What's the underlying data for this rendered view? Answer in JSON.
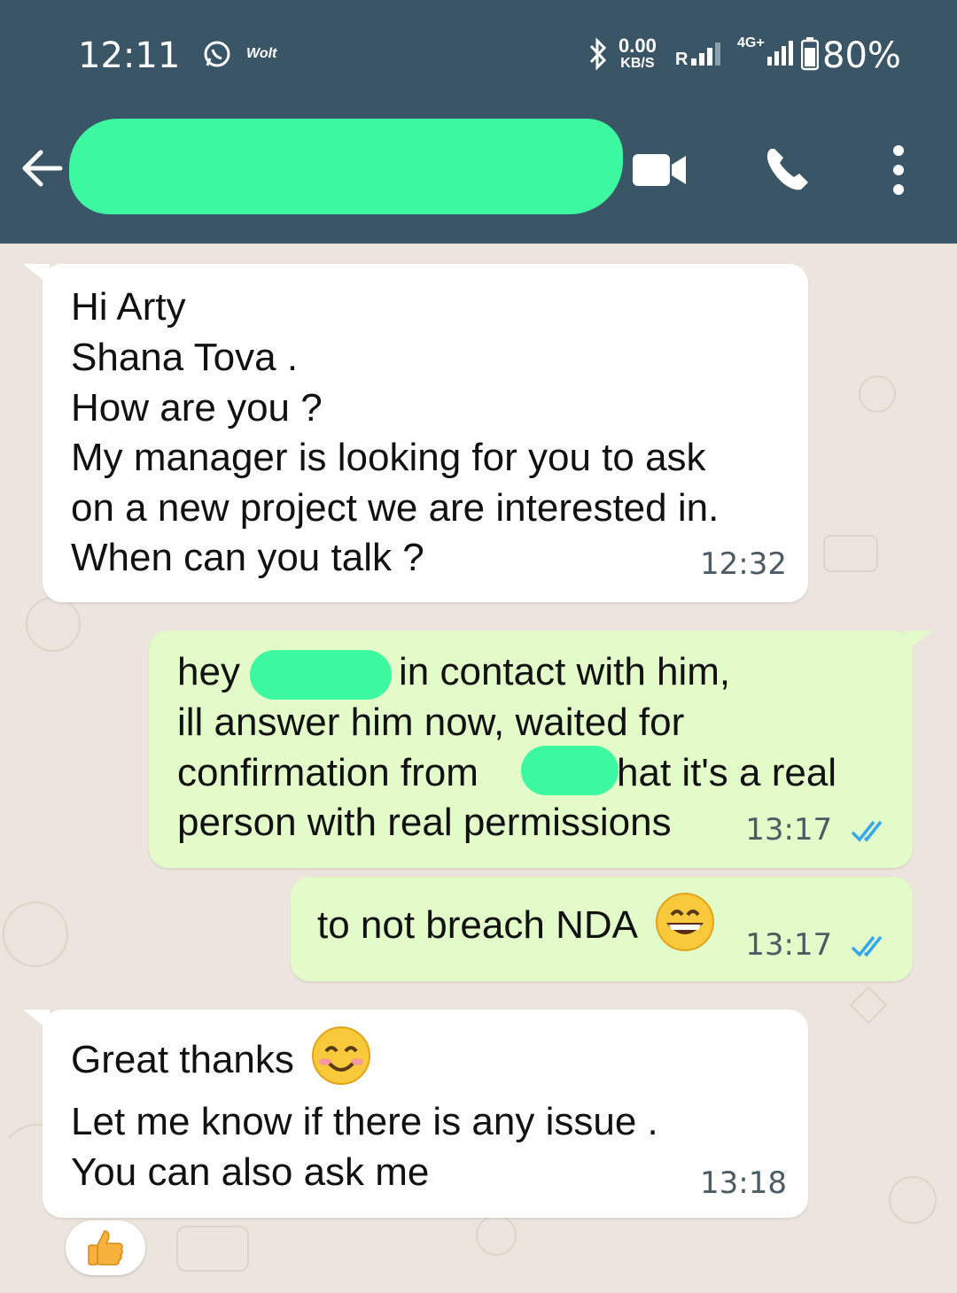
{
  "status_bar": {
    "time": "12:11",
    "wolt": "Wolt",
    "speed_value": "0.00",
    "speed_unit": "KB/S",
    "net1": "R",
    "net2": "4G+",
    "battery": "80%"
  },
  "header": {
    "accent_color": "#3a5566",
    "redaction_color": "#3cf8a0"
  },
  "messages": [
    {
      "direction": "incoming",
      "lines": [
        "Hi Arty",
        "Shana Tova .",
        "How are you ?",
        "My manager is looking for you to ask",
        "on a new project we are interested in.",
        "When can you talk ?"
      ],
      "time": "12:32"
    },
    {
      "direction": "outgoing",
      "lines": [
        "hey",
        "in contact with him,",
        "ill answer him now, waited for",
        "confirmation from",
        "hat it's a real",
        "person with real permissions"
      ],
      "time": "13:17",
      "status": "read"
    },
    {
      "direction": "outgoing",
      "text": "to not breach NDA",
      "emoji": "grinning-face",
      "time": "13:17",
      "status": "read"
    },
    {
      "direction": "incoming",
      "first": "Great thanks",
      "emoji": "smiling-face",
      "lines": [
        "Let me know if there is any issue .",
        "You can also ask me"
      ],
      "time": "13:18",
      "reaction": "thumbs-up"
    }
  ]
}
